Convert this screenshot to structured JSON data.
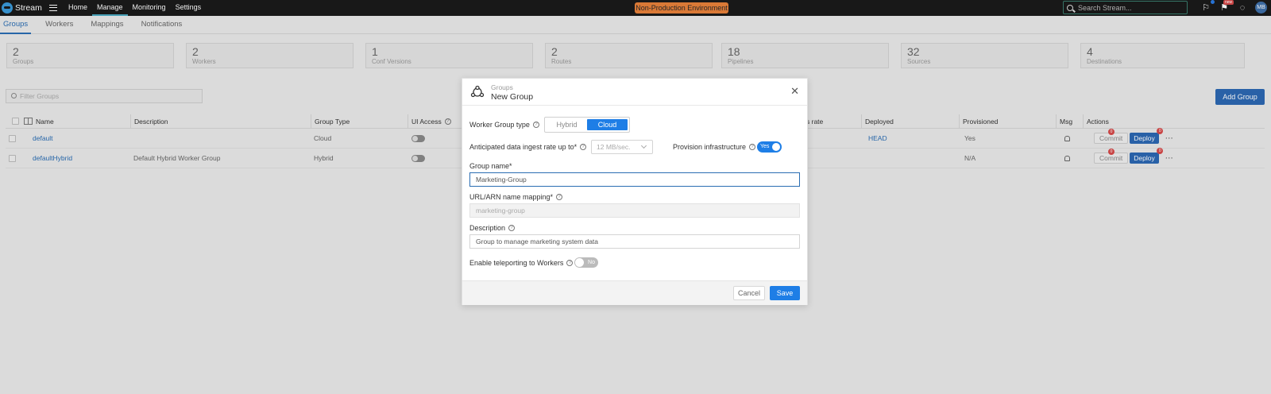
{
  "topbar": {
    "app_name": "Stream",
    "nav": [
      "Home",
      "Manage",
      "Monitoring",
      "Settings"
    ],
    "active_nav": "Manage",
    "environment_badge": "Non-Production Environment",
    "search_placeholder": "Search Stream...",
    "new_badge": "new",
    "avatar_initials": "MB"
  },
  "subnav": {
    "tabs": [
      "Groups",
      "Workers",
      "Mappings",
      "Notifications"
    ],
    "active_tab": "Groups"
  },
  "stats": [
    {
      "value": "2",
      "label": "Groups"
    },
    {
      "value": "2",
      "label": "Workers"
    },
    {
      "value": "1",
      "label": "Conf Versions"
    },
    {
      "value": "2",
      "label": "Routes"
    },
    {
      "value": "18",
      "label": "Pipelines"
    },
    {
      "value": "32",
      "label": "Sources"
    },
    {
      "value": "4",
      "label": "Destinations"
    }
  ],
  "filter_placeholder": "Filter Groups",
  "add_group_label": "Add Group",
  "table": {
    "headers": {
      "name": "Name",
      "description": "Description",
      "group_type": "Group Type",
      "ui_access": "UI Access",
      "rate": "s rate",
      "deployed": "Deployed",
      "provisioned": "Provisioned",
      "msg": "Msg",
      "actions": "Actions"
    },
    "rows": [
      {
        "name": "default",
        "description": "",
        "group_type": "Cloud",
        "deployed": "HEAD",
        "provisioned": "Yes",
        "commit": "Commit",
        "deploy": "Deploy",
        "commit_badge": "0",
        "deploy_badge": "0"
      },
      {
        "name": "defaultHybrid",
        "description": "Default Hybrid Worker Group",
        "group_type": "Hybrid",
        "deployed": "",
        "provisioned": "N/A",
        "commit": "Commit",
        "deploy": "Deploy",
        "commit_badge": "0",
        "deploy_badge": "0"
      }
    ]
  },
  "modal": {
    "breadcrumb": "Groups",
    "title": "New Group",
    "worker_group_type_label": "Worker Group type",
    "type_options": [
      "Hybrid",
      "Cloud"
    ],
    "selected_type": "Cloud",
    "ingest_rate_label": "Anticipated data ingest rate up to*",
    "ingest_rate_value": "12 MB/sec.",
    "provision_label": "Provision infrastructure",
    "provision_toggle": "Yes",
    "group_name_label": "Group name*",
    "group_name_value": "Marketing-Group",
    "url_arn_label": "URL/ARN name mapping*",
    "url_arn_value": "marketing-group",
    "description_label": "Description",
    "description_value": "Group to manage marketing system data",
    "teleport_label": "Enable teleporting to Workers",
    "teleport_toggle": "No",
    "cancel_label": "Cancel",
    "save_label": "Save"
  },
  "colors": {
    "primary": "#1e7ee6",
    "topbar": "#1a1a1a",
    "env_badge": "#e8813a",
    "link": "#2a6db3",
    "badge_red": "#d64a4a"
  }
}
